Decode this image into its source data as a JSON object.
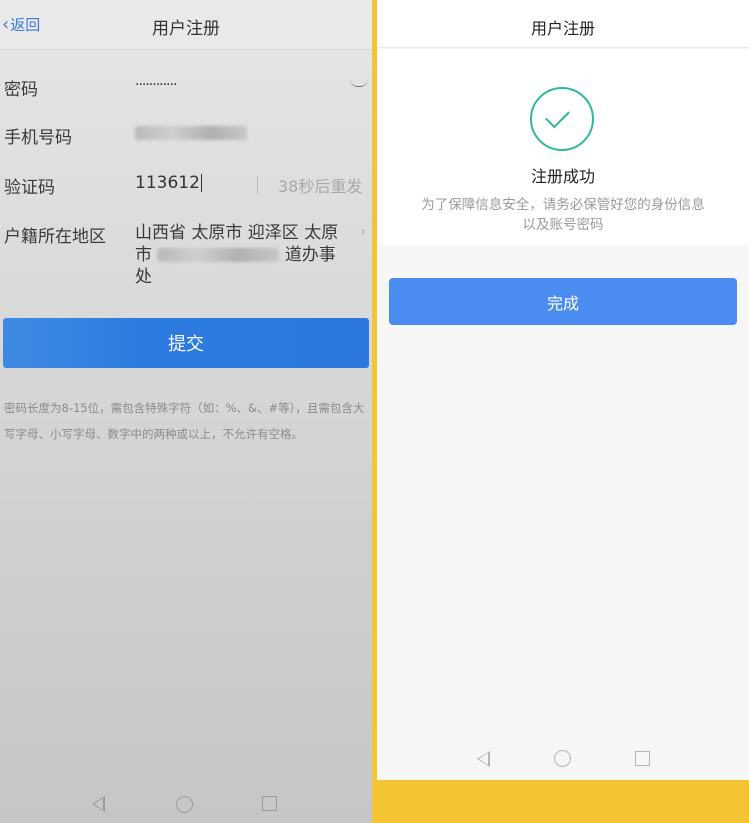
{
  "left_screen": {
    "header": {
      "back_label": "返回",
      "title": "用户注册"
    },
    "form": {
      "password": {
        "label": "密码",
        "value": "············"
      },
      "phone": {
        "label": "手机号码"
      },
      "code": {
        "label": "验证码",
        "value": "113612",
        "resend": "38秒后重发"
      },
      "region": {
        "label": "户籍所在地区",
        "line1": "山西省 太原市 迎泽区 太原",
        "line2_prefix": "市",
        "line2_suffix": "道办事处"
      }
    },
    "submit_label": "提交",
    "hint": "密码长度为8-15位，需包含特殊字符（如：%、&、#等），且需包含大写字母、小写字母、数字中的两种或以上，不允许有空格。"
  },
  "right_screen": {
    "header": {
      "title": "用户注册"
    },
    "success": {
      "title": "注册成功",
      "description": "为了保障信息安全，请务必保管好您的身份信息以及账号密码"
    },
    "done_label": "完成"
  },
  "colors": {
    "frame": "#f5c433",
    "primary_blue": "#4a8cf0",
    "success_green": "#2fb89f"
  }
}
